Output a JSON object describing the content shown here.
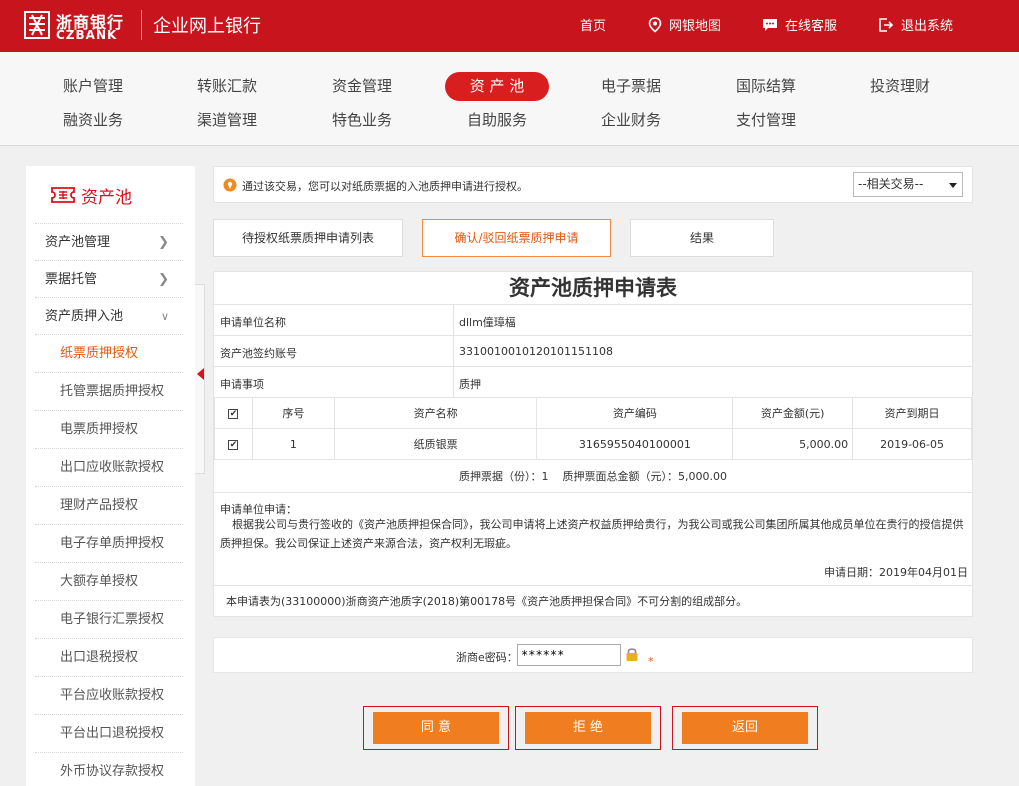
{
  "header": {
    "logo_cn": "浙商银行",
    "logo_en": "CZBANK",
    "site_title": "企业网上银行",
    "links": [
      "首页",
      "网银地图",
      "在线客服",
      "退出系统"
    ]
  },
  "main_nav": {
    "row1": [
      "账户管理",
      "转账汇款",
      "资金管理",
      "资 产 池",
      "电子票据",
      "国际结算",
      "投资理财"
    ],
    "row2": [
      "融资业务",
      "渠道管理",
      "特色业务",
      "自助服务",
      "企业财务",
      "支付管理"
    ]
  },
  "sidebar": {
    "title": "资产池",
    "items": [
      "资产池管理",
      "票据托管",
      "资产质押入池",
      "纸票质押授权",
      "托管票据质押授权",
      "电票质押授权",
      "出口应收账款授权",
      "理财产品授权",
      "电子存单质押授权",
      "大额存单授权",
      "电子银行汇票授权",
      "出口退税授权",
      "平台应收账款授权",
      "平台出口退税授权",
      "外币协议存款授权"
    ]
  },
  "notice": {
    "text": "通过该交易，您可以对纸质票据的入池质押申请进行授权。",
    "related_select": "--相关交易--"
  },
  "steps": [
    "待授权纸票质押申请列表",
    "确认/驳回纸票质押申请",
    "结果"
  ],
  "form": {
    "title": "资产池质押申请表",
    "applicant_label": "申请单位名称",
    "applicant_value": "dllm僮璋楅",
    "account_label": "资产池签约账号",
    "account_value": "3310010010120101151108",
    "matter_label": "申请事项",
    "matter_value": "质押",
    "table_headers": [
      "序号",
      "资产名称",
      "资产编码",
      "资产金额(元)",
      "资产到期日"
    ],
    "table_rows": [
      {
        "no": "1",
        "name": "纸质银票",
        "code": "3165955040100001",
        "amount": "5,000.00",
        "due": "2019-06-05"
      }
    ],
    "summary": "质押票据（份）：1    质押票面总金额（元）：5,000.00",
    "statement_head": "申请单位申请：",
    "statement_body": "根据我公司与贵行签收的《资产池质押担保合同》，我公司申请将上述资产权益质押给贵行，为我公司或我公司集团所属其他成员单位在贵行的授信提供质押担保。我公司保证上述资产来源合法，资产权利无瑕疵。",
    "apply_date": "申请日期：2019年04月01日",
    "contract_note": "本申请表为(33100000)浙商资产池质字(2018)第00178号《资产池质押担保合同》不可分割的组成部分。"
  },
  "password": {
    "label": "浙商e密码：",
    "value": "******",
    "required_mark": "*"
  },
  "buttons": [
    "同 意",
    "拒 绝",
    "返回"
  ],
  "colors": {
    "brand_red": "#c8151d",
    "accent_orange": "#f07d20"
  }
}
